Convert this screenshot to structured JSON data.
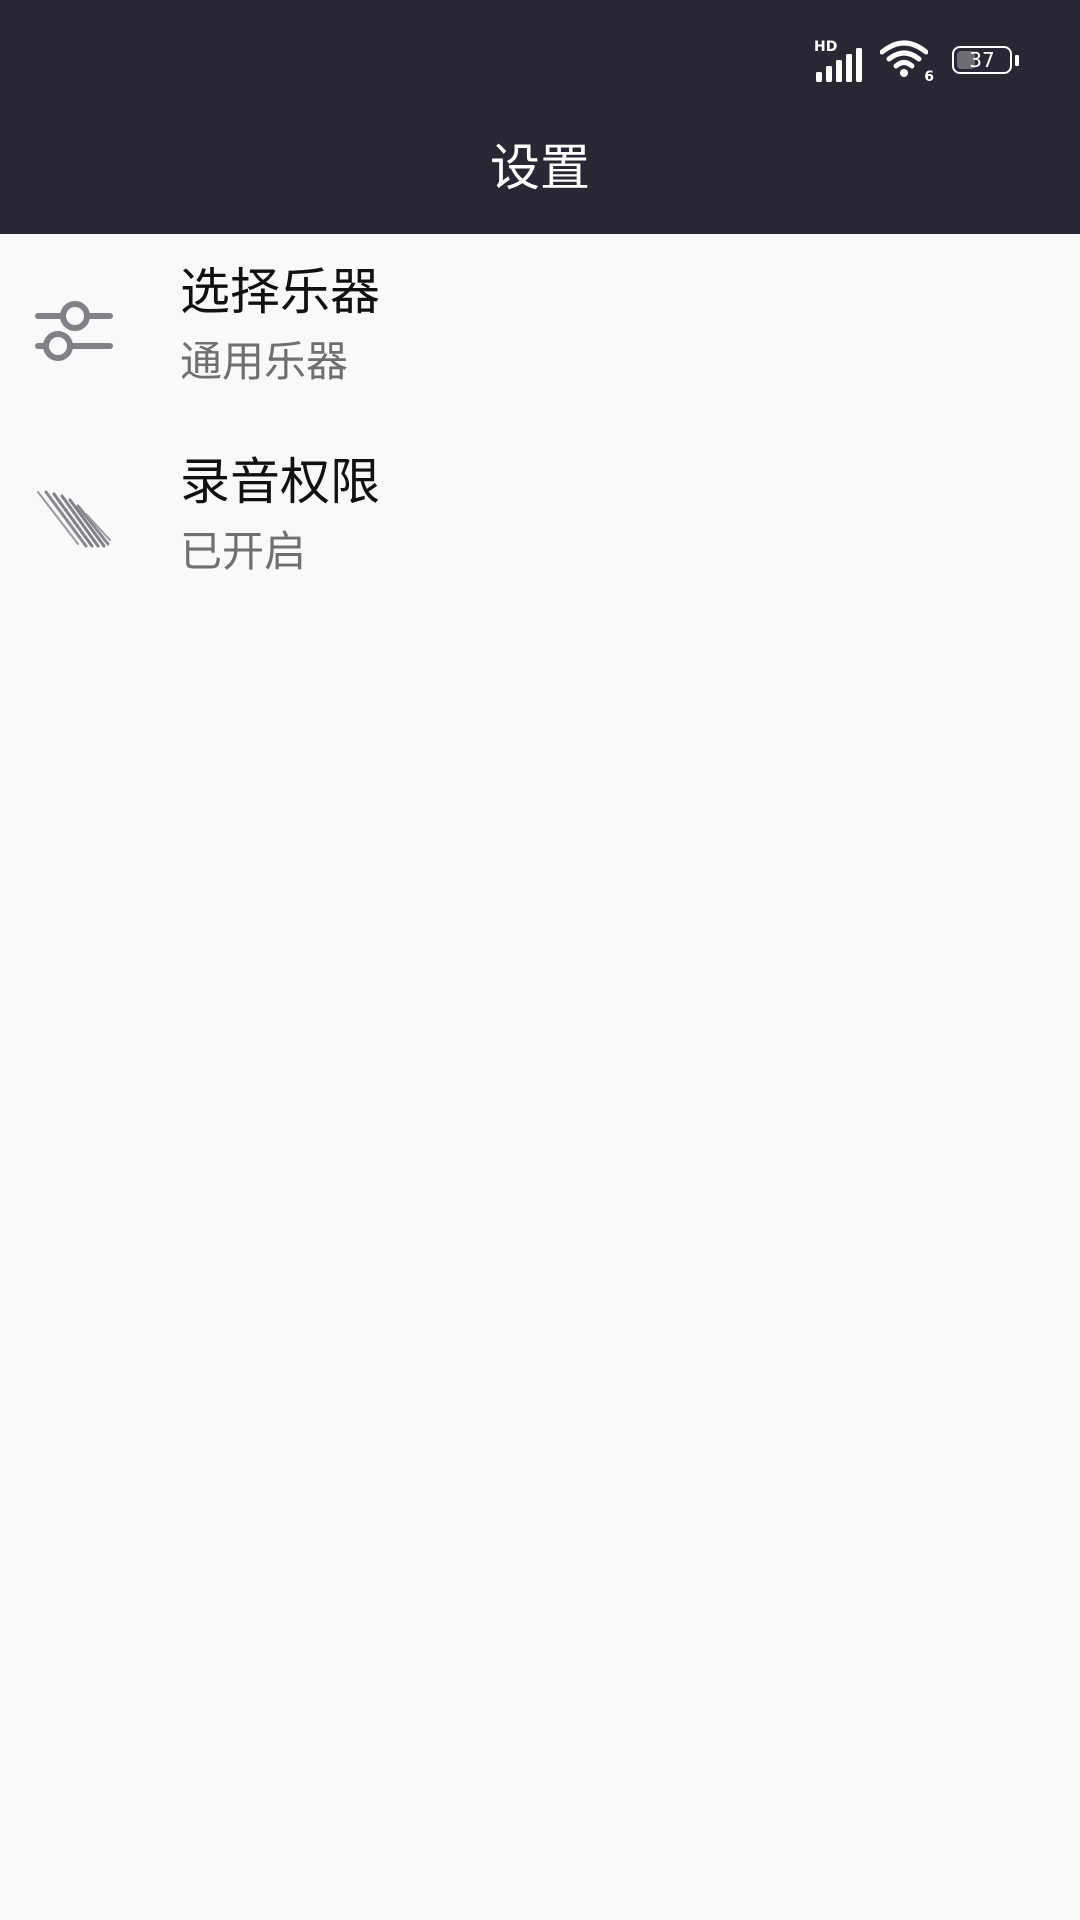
{
  "status_bar": {
    "signal_label": "HD",
    "wifi_label": "6",
    "battery_level": "37"
  },
  "header": {
    "title": "设置"
  },
  "settings": [
    {
      "label": "选择乐器",
      "value": "通用乐器",
      "icon": "sliders-icon"
    },
    {
      "label": "录音权限",
      "value": "已开启",
      "icon": "hatch-icon"
    }
  ],
  "colors": {
    "appbar": "#272834",
    "background": "#f9f9fa",
    "icon": "#808085",
    "primary_text": "#111111",
    "secondary_text": "#6f6f6f"
  }
}
